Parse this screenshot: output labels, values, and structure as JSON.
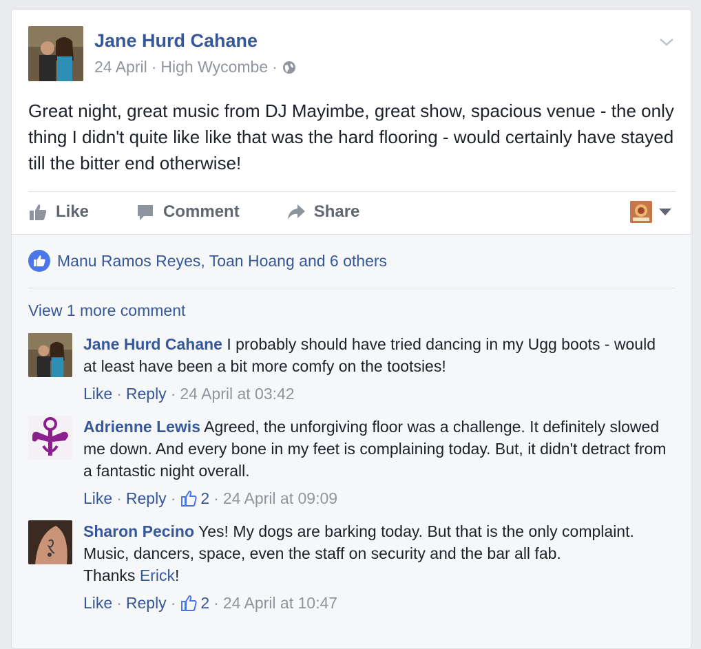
{
  "post": {
    "author": "Jane Hurd Cahane",
    "date": "24 April",
    "location": "High Wycombe",
    "text": "Great night, great music from DJ Mayimbe, great show, spacious venue - the only thing I didn't quite like like that was the hard flooring - would certainly have stayed till the bitter end otherwise!"
  },
  "actions": {
    "like_label": "Like",
    "comment_label": "Comment",
    "share_label": "Share"
  },
  "likes": {
    "summary": "Manu Ramos Reyes, Toan Hoang and 6 others"
  },
  "view_more": "View 1 more comment",
  "comments": [
    {
      "author": "Jane Hurd Cahane",
      "text": "I probably should have tried dancing in my Ugg boots - would at least have been a bit more comfy on the tootsies!",
      "like": "Like",
      "reply": "Reply",
      "likes": "",
      "time": "24 April at 03:42"
    },
    {
      "author": "Adrienne Lewis",
      "text": "Agreed, the unforgiving floor was a challenge. It definitely slowed me down. And every bone in my feet is complaining today. But, it didn't detract from a fantastic night overall.",
      "like": "Like",
      "reply": "Reply",
      "likes": "2",
      "time": "24 April at 09:09"
    },
    {
      "author": "Sharon Pecino",
      "text": "Yes! My dogs are barking today. But that is the only complaint. Music, dancers, space, even the staff on security and the bar all fab.",
      "text2_prefix": "Thanks ",
      "text2_link": "Erick",
      "text2_suffix": "!",
      "like": "Like",
      "reply": "Reply",
      "likes": "2",
      "time": "24 April at 10:47"
    }
  ],
  "colors": {
    "link": "#365899",
    "meta": "#90949c",
    "like_blue": "#4a76e8",
    "background": "#e9ebee"
  },
  "icons": [
    "globe-icon",
    "chevron-down-icon",
    "like-icon",
    "comment-icon",
    "share-icon",
    "like-badge-icon",
    "thumbs-up-icon",
    "caret-down-icon"
  ]
}
